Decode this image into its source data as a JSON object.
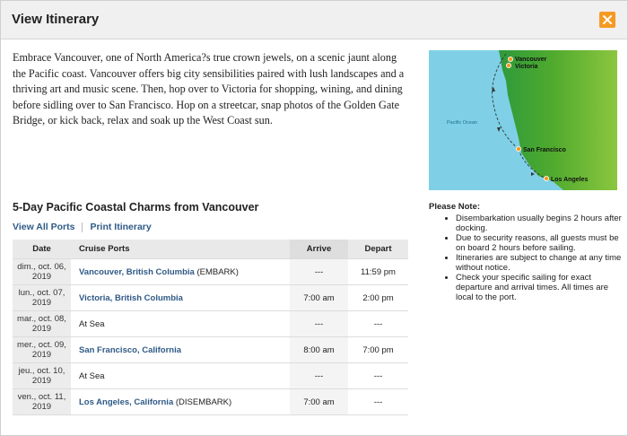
{
  "modal": {
    "title": "View Itinerary",
    "close_icon": "close-icon",
    "accent": "#f59a23"
  },
  "description": "Embrace Vancouver, one of North America?s true crown jewels, on a scenic jaunt along the Pacific coast. Vancouver offers big city sensibilities paired with lush landscapes and a thriving art and music scene. Then, hop over to Victoria for shopping, wining, and dining before sidling over to San Francisco. Hop on a streetcar, snap photos of the Golden Gate Bridge, or kick back, relax and soak up the West Coast sun.",
  "map": {
    "ocean_label": "Pacific Ocean",
    "labels": {
      "vancouver": "Vancouver",
      "victoria": "Victoria",
      "san_francisco": "San Francisco",
      "los_angeles": "Los Angeles"
    }
  },
  "itinerary": {
    "title": "5-Day Pacific Coastal Charms from Vancouver",
    "links": {
      "view_all_ports": "View All Ports",
      "print": "Print Itinerary"
    },
    "headers": {
      "date": "Date",
      "ports": "Cruise Ports",
      "arrive": "Arrive",
      "depart": "Depart"
    },
    "rows": [
      {
        "date": "dim., oct. 06, 2019",
        "port": "Vancouver, British Columbia",
        "note": "(EMBARK)",
        "arrive": "---",
        "depart": "11:59 pm"
      },
      {
        "date": "lun., oct. 07, 2019",
        "port": "Victoria, British Columbia",
        "note": "",
        "arrive": "7:00 am",
        "depart": "2:00 pm"
      },
      {
        "date": "mar., oct. 08, 2019",
        "port": "At Sea",
        "note": "",
        "arrive": "---",
        "depart": "---"
      },
      {
        "date": "mer., oct. 09, 2019",
        "port": "San Francisco, California",
        "note": "",
        "arrive": "8:00 am",
        "depart": "7:00 pm"
      },
      {
        "date": "jeu., oct. 10, 2019",
        "port": "At Sea",
        "note": "",
        "arrive": "---",
        "depart": "---"
      },
      {
        "date": "ven., oct. 11, 2019",
        "port": "Los Angeles, California",
        "note": "(DISEMBARK)",
        "arrive": "7:00 am",
        "depart": "---"
      }
    ]
  },
  "notes": {
    "title": "Please Note:",
    "items": [
      "Disembarkation usually begins 2 hours after docking.",
      "Due to security reasons, all guests must be on board 2 hours before sailing.",
      "Itineraries are subject to change at any time without notice.",
      "Check your specific sailing for exact departure and arrival times. All times are local to the port."
    ]
  }
}
